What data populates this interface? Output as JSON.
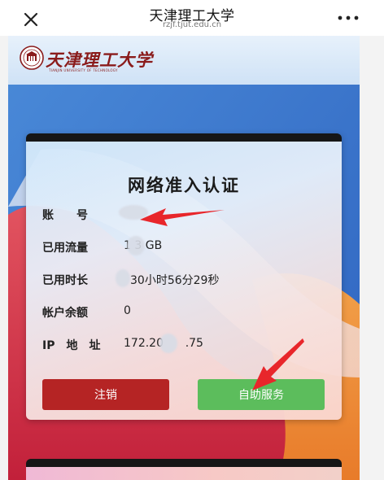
{
  "nav": {
    "title": "天津理工大学",
    "subtitle": "rzjf.tjut.edu.cn",
    "close_icon": "close-icon",
    "more_icon": "more-dots-icon"
  },
  "header": {
    "logo_icon": "university-seal-icon",
    "logo_text": "天津理工大学",
    "logo_subtext": "TIANJIN UNIVERSITY OF TECHNOLOGY"
  },
  "card": {
    "title": "网络准入认证",
    "rows": [
      {
        "label": "账　　号",
        "value": ""
      },
      {
        "label": "已用流量",
        "value": "1  3 GB"
      },
      {
        "label": "已用时长",
        "value": "30小时56分29秒"
      },
      {
        "label": "帐户余额",
        "value": "0"
      },
      {
        "label": "IP　地　址",
        "value": "172.20      .75"
      }
    ],
    "buttons": {
      "logout": "注销",
      "self_service": "自助服务"
    }
  },
  "colors": {
    "logout_button": "#b52424",
    "self_service_button": "#5cbd5c",
    "annotation_arrow": "#e8262b",
    "brand": "#8a1b1b"
  }
}
